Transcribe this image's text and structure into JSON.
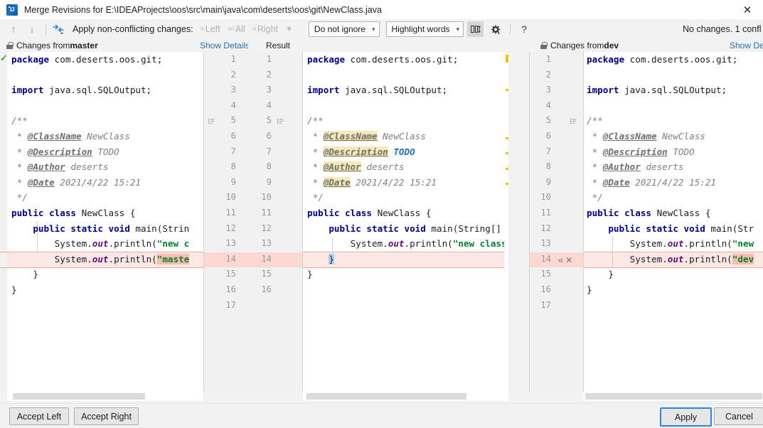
{
  "window": {
    "title": "Merge Revisions for E:\\IDEAProjects\\oos\\src\\main\\java\\com\\deserts\\oos\\git\\NewClass.java",
    "close_label": "✕",
    "logo_label": "IJ"
  },
  "toolbar": {
    "prev_label": "↑",
    "next_label": "↓",
    "apply_changes_label": "Apply non-conflicting changes:",
    "left_label": "Left",
    "all_label": "All",
    "right_label": "Right",
    "ignore_select": "Do not ignore",
    "highlight_select": "Highlight words",
    "help_label": "?",
    "status": "No changes. 1 confl"
  },
  "panes": {
    "left_header": "Changes from ",
    "left_branch": "master",
    "left_show_details": "Show Details",
    "result_header": "Result",
    "right_header": "Changes from ",
    "right_branch": "dev",
    "right_show_details": "Show Deta"
  },
  "gutter": {
    "left_numbers": [
      "1",
      "2",
      "3",
      "4",
      "5",
      "6",
      "7",
      "8",
      "9",
      "10",
      "11",
      "12",
      "13",
      "14",
      "15",
      "16",
      "17"
    ],
    "right_numbers": [
      "1",
      "2",
      "3",
      "4",
      "5",
      "6",
      "7",
      "8",
      "9",
      "10",
      "11",
      "12",
      "13",
      "14",
      "15",
      "16"
    ],
    "far_right_numbers": [
      "1",
      "2",
      "3",
      "4",
      "5",
      "6",
      "7",
      "8",
      "9",
      "10",
      "11",
      "12",
      "13",
      "14",
      "15",
      "16",
      "17"
    ],
    "conflict_line": "14",
    "conflict_marks_center": [
      "✕",
      "»"
    ],
    "conflict_marks_right": [
      "«",
      "✕"
    ]
  },
  "code": {
    "package": "package",
    "import": "import",
    "package_name": " com.deserts.oos.git;",
    "import_name": " java.sql.SQLOutput;",
    "javadoc_open": "/**",
    "javadoc_close": " */",
    "star": " * ",
    "tag_classname": "@ClassName",
    "val_classname": " NewClass",
    "tag_description": "@Description",
    "val_description": "TODO",
    "tag_author": "@Author",
    "val_author": " deserts",
    "tag_date": "@Date",
    "val_date": " 2021/4/22 15:21",
    "class_decl_kw": "public class",
    "class_decl_name": " NewClass {",
    "main_kw": "public static void",
    "main_sig_full": " main(String[] a",
    "main_sig_clip": " main(Strin",
    "main_sig_clip_right": " main(Str",
    "sys": "System.",
    "out": "out",
    "println": ".println(",
    "str_new_class": "\"new class\"",
    "str_new_clip": "\"new c",
    "str_new_clip_right": "\"new",
    "str_master_clip": "\"maste",
    "str_dev_clip": "\"dev",
    "brace_close": "}",
    "brace_close_indent": "    }"
  },
  "buttons": {
    "accept_left": "Accept Left",
    "accept_right": "Accept Right",
    "apply": "Apply",
    "cancel": "Cancel"
  },
  "colors": {
    "accent": "#2470b3",
    "keyword": "#000080",
    "string": "#0a7c2f",
    "conflict_bg": "#fbe7e4",
    "highlight": "#f5e9b8",
    "stripe": "#f2c200"
  }
}
